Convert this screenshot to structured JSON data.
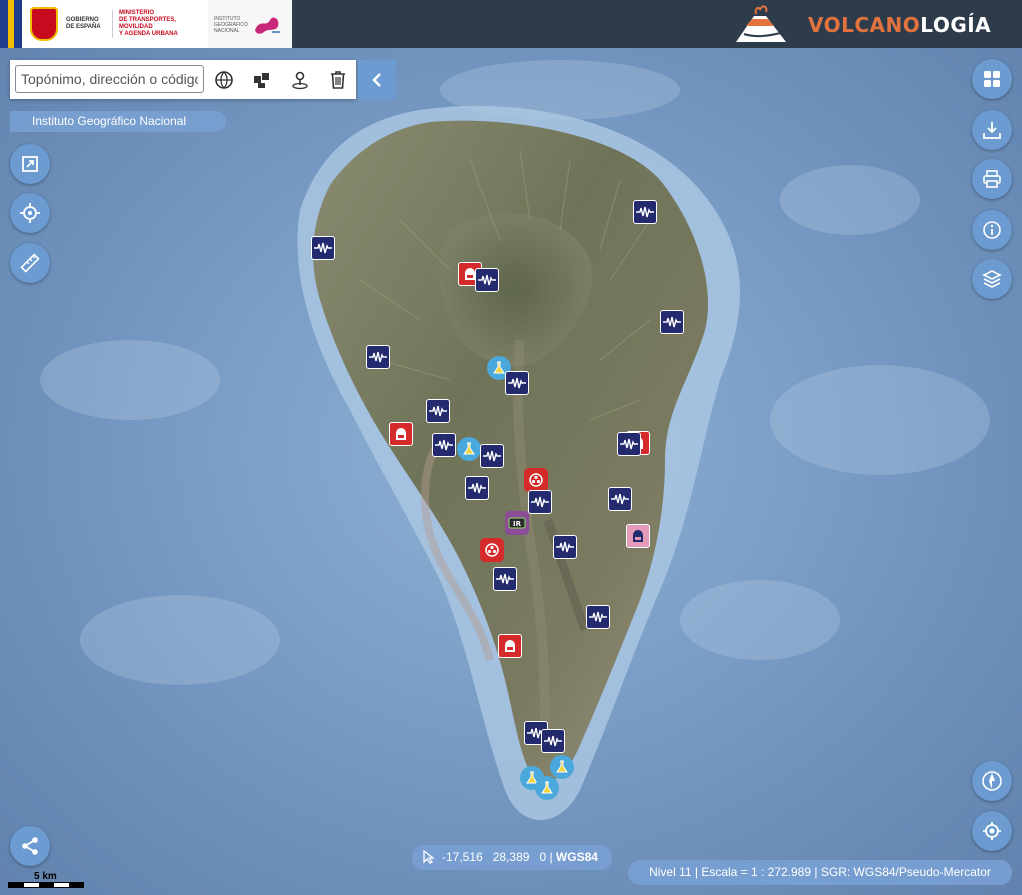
{
  "header": {
    "gov_line1": "GOBIERNO",
    "gov_line2": "DE ESPAÑA",
    "ministry_line1": "MINISTERIO",
    "ministry_line2": "DE TRANSPORTES, MOVILIDAD",
    "ministry_line3": "Y AGENDA URBANA",
    "ign_line1": "INSTITUTO",
    "ign_line2": "GEOGRÁFICO",
    "ign_line3": "NACIONAL",
    "brand_part1": "VOLCANO",
    "brand_part2": "LOGÍA",
    "brand_colors": {
      "accent": "#e2733f",
      "bar": "#2e3b4a"
    }
  },
  "search": {
    "placeholder": "Topónimo, dirección o código",
    "tools": [
      "globe-icon",
      "cadastre-icon",
      "pin-icon",
      "trash-icon"
    ]
  },
  "attribution": "Instituto Geográfico Nacional",
  "left_tools": [
    "fullscreen-icon",
    "locate-icon",
    "measure-icon"
  ],
  "right_tools": [
    "grid-icon",
    "download-icon",
    "print-icon",
    "info-icon",
    "layers-icon"
  ],
  "coords": {
    "lon": "-17,516",
    "lat": "28,389",
    "alt": "0",
    "srs": "WGS84"
  },
  "scale_info": "Nivel 11  |  Escala = 1 : 272.989  |  SGR: WGS84/Pseudo-Mercator",
  "scalebar_label": "5 km",
  "colors": {
    "ui_blue": "#6b9bd0",
    "seismic_station": "#232a6e",
    "gps_station": "#d42a2a",
    "lab_sample": "#4aa8dc"
  }
}
